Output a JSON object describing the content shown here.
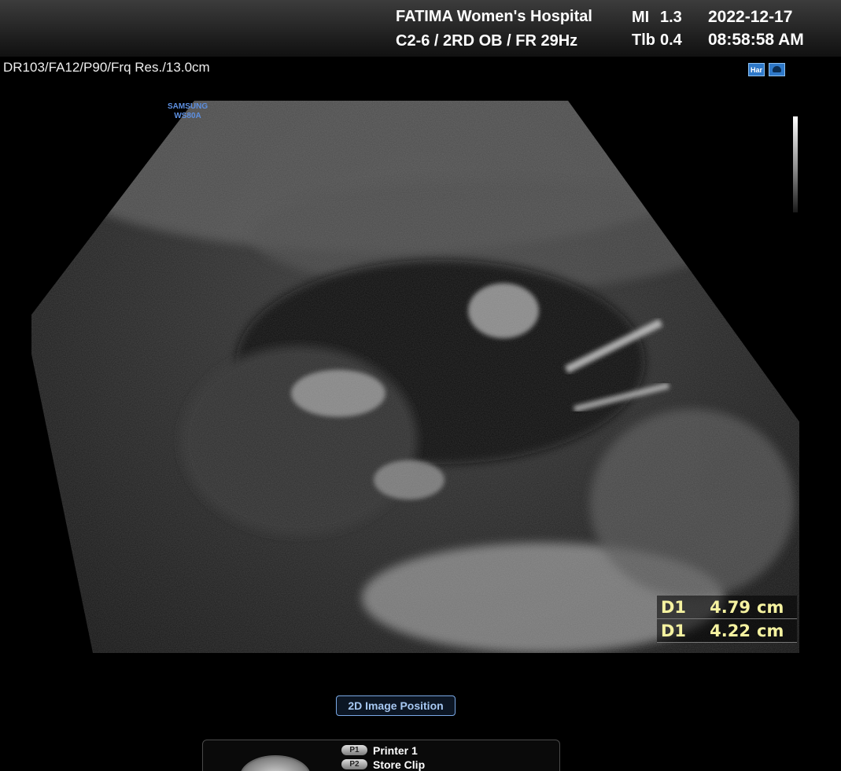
{
  "header": {
    "hospital": "FATIMA Women's Hospital",
    "probe_preset": "C2-6 / 2RD OB / FR 29Hz",
    "mi_label": "MI",
    "mi_value": "1.3",
    "tib_label": "Tlb",
    "tib_value": "0.4",
    "date": "2022-12-17",
    "time": "08:58:58 AM"
  },
  "image_params": "DR103/FA12/P90/Frq Res./13.0cm",
  "icons": {
    "harmonic": {
      "name": "harmonic-icon",
      "text": "Har"
    },
    "mode": {
      "name": "probe-mode-icon"
    }
  },
  "brand": {
    "maker": "SAMSUNG",
    "model": "WS80A",
    "color": "#5d8fe0"
  },
  "measurements": [
    {
      "label": "D1",
      "value": "4.79",
      "unit": "cm"
    },
    {
      "label": "D1",
      "value": "4.22",
      "unit": "cm"
    }
  ],
  "measurement_color": "#f5f2a0",
  "position_button": "2D Image Position",
  "soft_keys": [
    {
      "key": "P1",
      "label": "Printer 1"
    },
    {
      "key": "P2",
      "label": "Store Clip"
    }
  ]
}
